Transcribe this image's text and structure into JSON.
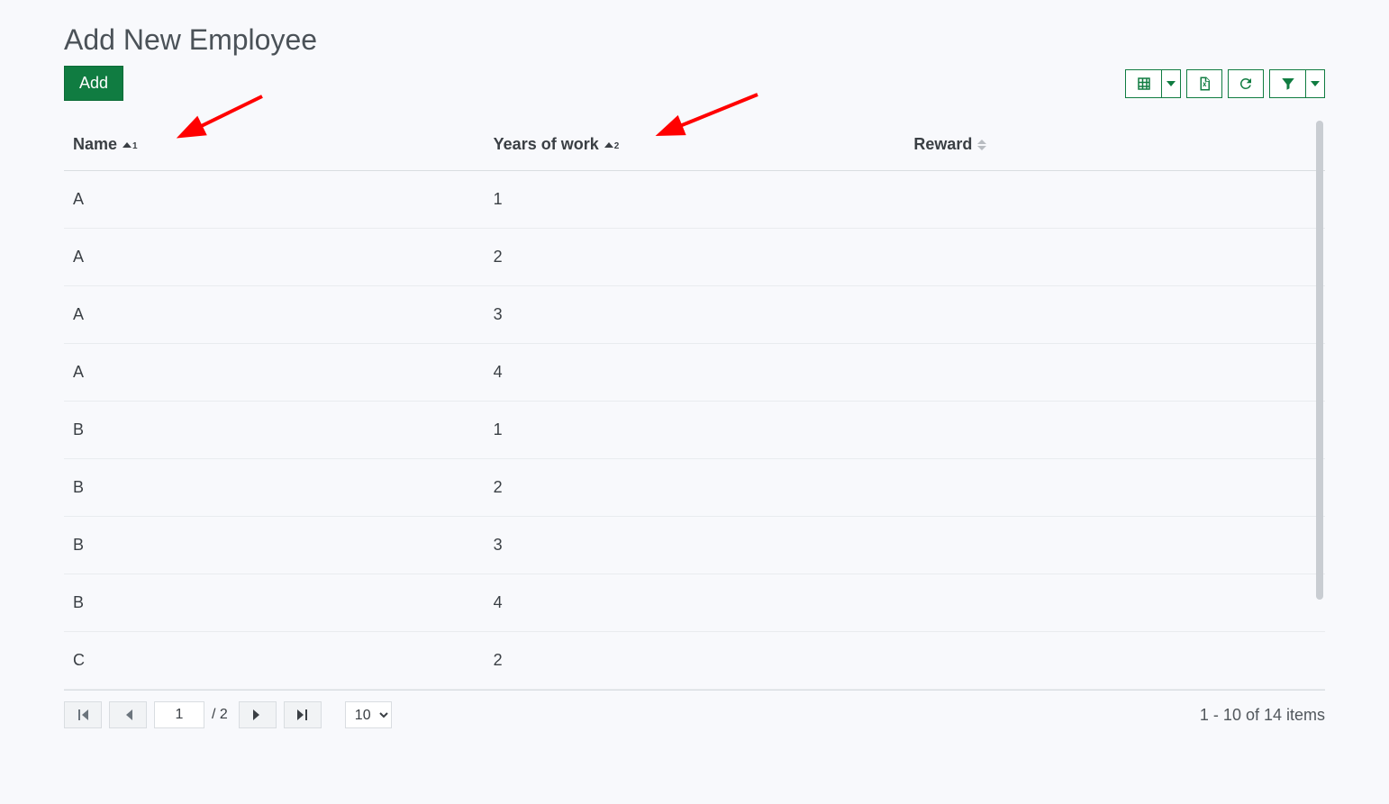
{
  "title": "Add New Employee",
  "toolbar": {
    "add_label": "Add"
  },
  "columns": {
    "name": {
      "label": "Name",
      "sort_dir": "asc",
      "sort_index": "1"
    },
    "years": {
      "label": "Years of work",
      "sort_dir": "asc",
      "sort_index": "2"
    },
    "reward": {
      "label": "Reward",
      "sort_dir": "none"
    }
  },
  "rows": [
    {
      "name": "A",
      "years": "1",
      "reward": ""
    },
    {
      "name": "A",
      "years": "2",
      "reward": ""
    },
    {
      "name": "A",
      "years": "3",
      "reward": ""
    },
    {
      "name": "A",
      "years": "4",
      "reward": ""
    },
    {
      "name": "B",
      "years": "1",
      "reward": ""
    },
    {
      "name": "B",
      "years": "2",
      "reward": ""
    },
    {
      "name": "B",
      "years": "3",
      "reward": ""
    },
    {
      "name": "B",
      "years": "4",
      "reward": ""
    },
    {
      "name": "C",
      "years": "2",
      "reward": ""
    }
  ],
  "pager": {
    "current_page": "1",
    "total_pages_label": "/ 2",
    "page_size_selected": "10",
    "page_size_options": [
      "10"
    ],
    "info": "1 - 10 of 14 items"
  }
}
